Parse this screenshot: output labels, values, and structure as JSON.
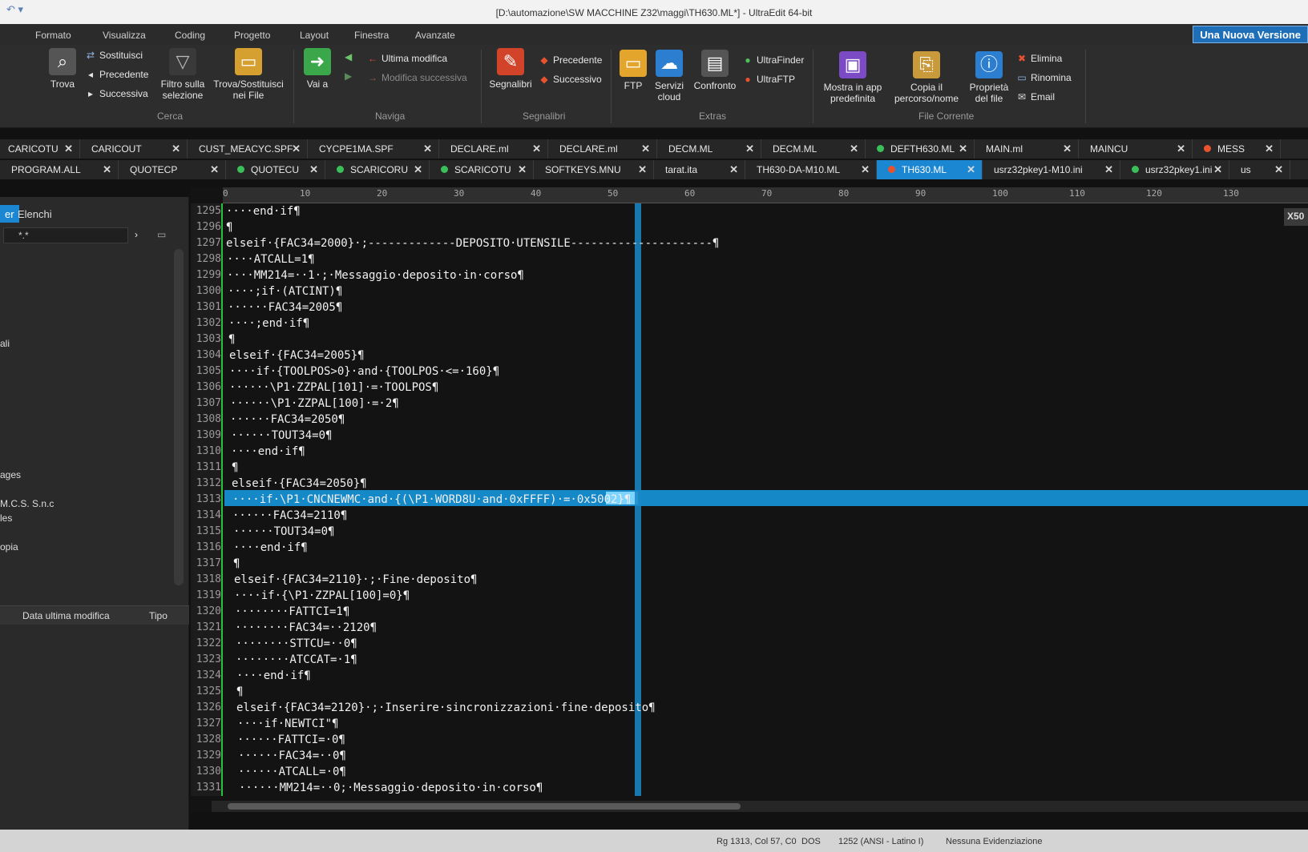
{
  "window": {
    "title": "[D:\\automazione\\SW MACCHINE Z32\\maggi\\TH630.ML*] - UltraEdit 64-bit"
  },
  "menu": {
    "items": [
      "Formato",
      "Visualizza",
      "Coding",
      "Progetto",
      "Layout",
      "Finestra",
      "Avanzate"
    ],
    "promo": "Una Nuova Versione"
  },
  "ribbon": {
    "cerca": {
      "trova": "Trova",
      "sostituisci": "Sostituisci",
      "precedente": "Precedente",
      "successiva": "Successiva",
      "filtro": "Filtro sulla selezione",
      "trova_sost": "Trova/Sostituisci nei File",
      "group": "Cerca"
    },
    "naviga": {
      "vai": "Vai a",
      "ultima": "Ultima modifica",
      "modifica_succ": "Modifica successiva",
      "group": "Naviga"
    },
    "segnalibri": {
      "segnalibri": "Segnalibri",
      "precedente": "Precedente",
      "successivo": "Successivo",
      "group": "Segnalibri"
    },
    "extras": {
      "ftp": "FTP",
      "servizi": "Servizi cloud",
      "confronto": "Confronto",
      "ultrafinder": "UltraFinder",
      "ultraftp": "UltraFTP",
      "group": "Extras"
    },
    "file": {
      "mostra": "Mostra in app predefinita",
      "copia": "Copia il percorso/nome",
      "proprieta": "Proprietà del file",
      "elimina": "Elimina",
      "rinomina": "Rinomina",
      "email": "Email",
      "group": "File Corrente"
    }
  },
  "tabs_row1": [
    {
      "label": "CARICOTU",
      "dot": ""
    },
    {
      "label": "CARICOUT",
      "dot": ""
    },
    {
      "label": "CUST_MEACYC.SPF",
      "dot": ""
    },
    {
      "label": "CYCPE1MA.SPF",
      "dot": ""
    },
    {
      "label": "DECLARE.ml",
      "dot": ""
    },
    {
      "label": "DECLARE.ml",
      "dot": ""
    },
    {
      "label": "DECM.ML",
      "dot": ""
    },
    {
      "label": "DECM.ML",
      "dot": ""
    },
    {
      "label": "DEFTH630.ML",
      "dot": "#3bbf5a"
    },
    {
      "label": "MAIN.ml",
      "dot": ""
    },
    {
      "label": "MAINCU",
      "dot": ""
    },
    {
      "label": "MESS",
      "dot": "#e8522f"
    }
  ],
  "tabs_row2": [
    {
      "label": "PROGRAM.ALL",
      "dot": ""
    },
    {
      "label": "QUOTECP",
      "dot": ""
    },
    {
      "label": "QUOTECU",
      "dot": "#3bbf5a"
    },
    {
      "label": "SCARICORU",
      "dot": "#3bbf5a"
    },
    {
      "label": "SCARICOTU",
      "dot": "#3bbf5a"
    },
    {
      "label": "SOFTKEYS.MNU",
      "dot": ""
    },
    {
      "label": "tarat.ita",
      "dot": ""
    },
    {
      "label": "TH630-DA-M10.ML",
      "dot": ""
    },
    {
      "label": "TH630.ML",
      "dot": "#e8522f",
      "active": true
    },
    {
      "label": "usrz32pkey1-M10.ini",
      "dot": ""
    },
    {
      "label": "usrz32pkey1.ini",
      "dot": "#3bbf5a"
    },
    {
      "label": "us",
      "dot": ""
    }
  ],
  "left_panel": {
    "tab_active": "er",
    "tab_other": "Elenchi",
    "filter": "*.*",
    "items": [
      "ali",
      "ages",
      "M.C.S. S.n.c",
      "les",
      "opia"
    ],
    "col_date": "Data ultima modifica",
    "col_type": "Tipo"
  },
  "ruler_ticks": [
    "0",
    "10",
    "20",
    "30",
    "40",
    "50",
    "60",
    "70",
    "80",
    "90",
    "100",
    "110",
    "120",
    "130"
  ],
  "editor": {
    "badge": "X50",
    "lines": [
      {
        "n": "1295",
        "t": "····end·if¶"
      },
      {
        "n": "1296",
        "t": "¶"
      },
      {
        "n": "1297",
        "t": "elseif·{FAC34=2000}·;-------------DEPOSITO·UTENSILE---------------------¶"
      },
      {
        "n": "1298",
        "t": "····ATCALL=1¶"
      },
      {
        "n": "1299",
        "t": "····MM214=··1·;·Messaggio·deposito·in·corso¶"
      },
      {
        "n": "1300",
        "t": "····;if·(ATCINT)¶"
      },
      {
        "n": "1301",
        "t": "······FAC34=2005¶"
      },
      {
        "n": "1302",
        "t": "····;end·if¶"
      },
      {
        "n": "1303",
        "t": "¶"
      },
      {
        "n": "1304",
        "t": "elseif·{FAC34=2005}¶"
      },
      {
        "n": "1305",
        "t": "····if·{TOOLPOS>0}·and·{TOOLPOS·<=·160}¶"
      },
      {
        "n": "1306",
        "t": "······\\P1·ZZPAL[101]·=·TOOLPOS¶"
      },
      {
        "n": "1307",
        "t": "······\\P1·ZZPAL[100]·=·2¶"
      },
      {
        "n": "1308",
        "t": "······FAC34=2050¶"
      },
      {
        "n": "1309",
        "t": "······TOUT34=0¶"
      },
      {
        "n": "1310",
        "t": "····end·if¶"
      },
      {
        "n": "1311",
        "t": "¶"
      },
      {
        "n": "1312",
        "t": "elseif·{FAC34=2050}¶"
      },
      {
        "n": "1313",
        "t": "····if·\\P1·CNCNEWMC·and·{(\\P1·WORD8U·and·0xFFFF)·=·0x5002}¶"
      },
      {
        "n": "1314",
        "t": "······FAC34=2110¶"
      },
      {
        "n": "1315",
        "t": "······TOUT34=0¶"
      },
      {
        "n": "1316",
        "t": "····end·if¶"
      },
      {
        "n": "1317",
        "t": "¶"
      },
      {
        "n": "1318",
        "t": "elseif·{FAC34=2110}·;·Fine·deposito¶"
      },
      {
        "n": "1319",
        "t": "····if·{\\P1·ZZPAL[100]=0}¶"
      },
      {
        "n": "1320",
        "t": "········FATTCI=1¶"
      },
      {
        "n": "1321",
        "t": "········FAC34=··2120¶"
      },
      {
        "n": "1322",
        "t": "········STTCU=··0¶"
      },
      {
        "n": "1323",
        "t": "········ATCCAT=·1¶"
      },
      {
        "n": "1324",
        "t": "····end·if¶"
      },
      {
        "n": "1325",
        "t": "¶"
      },
      {
        "n": "1326",
        "t": "elseif·{FAC34=2120}·;·Inserire·sincronizzazioni·fine·deposito¶"
      },
      {
        "n": "1327",
        "t": "····if·NEWTCI\"¶"
      },
      {
        "n": "1328",
        "t": "······FATTCI=·0¶"
      },
      {
        "n": "1329",
        "t": "······FAC34=··0¶"
      },
      {
        "n": "1330",
        "t": "······ATCALL=·0¶"
      },
      {
        "n": "1331",
        "t": "······MM214=··0;·Messaggio·deposito·in·corso¶"
      }
    ]
  },
  "status": {
    "pos": "Rg 1313, Col 57, C0",
    "eol": "DOS",
    "enc": "1252 (ANSI - Latino I)",
    "hl": "Nessuna Evidenziazione"
  }
}
